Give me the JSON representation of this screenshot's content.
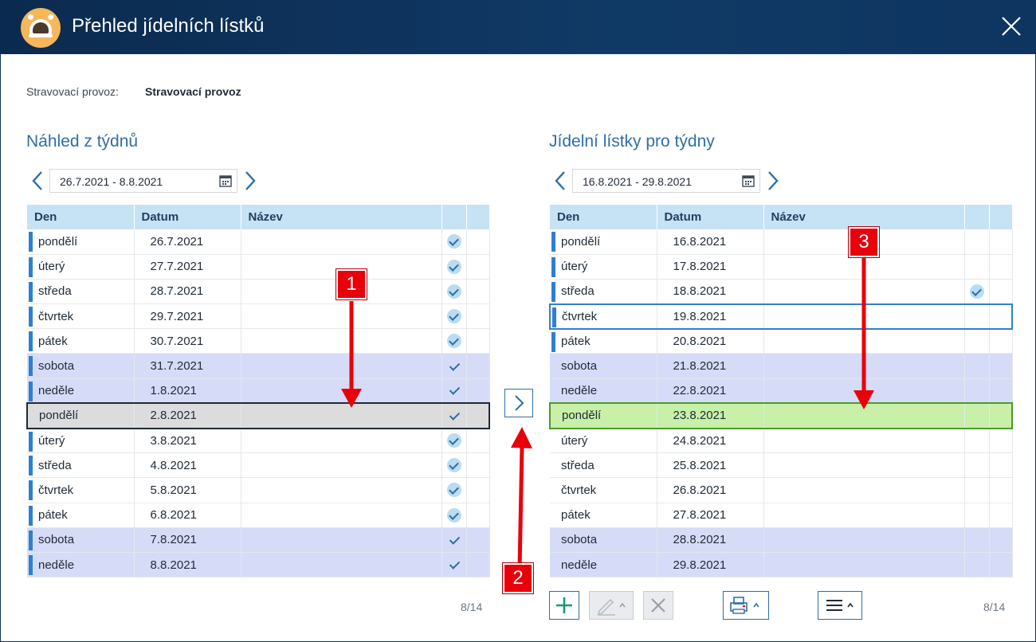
{
  "window": {
    "title": "Přehled jídelních lístků"
  },
  "provoz": {
    "label": "Stravovací provoz:",
    "value": "Stravovací provoz"
  },
  "left": {
    "title": "Náhled z týdnů",
    "date_range": "26.7.2021 - 8.8.2021",
    "columns": [
      "Den",
      "Datum",
      "Název"
    ],
    "rows": [
      {
        "day": "pondělí",
        "date": "26.7.2021",
        "check": "filled",
        "style": ""
      },
      {
        "day": "úterý",
        "date": "27.7.2021",
        "check": "filled",
        "style": ""
      },
      {
        "day": "středa",
        "date": "28.7.2021",
        "check": "filled",
        "style": ""
      },
      {
        "day": "čtvrtek",
        "date": "29.7.2021",
        "check": "filled",
        "style": ""
      },
      {
        "day": "pátek",
        "date": "30.7.2021",
        "check": "filled",
        "style": ""
      },
      {
        "day": "sobota",
        "date": "31.7.2021",
        "check": "plain",
        "style": "weekend"
      },
      {
        "day": "neděle",
        "date": "1.8.2021",
        "check": "plain",
        "style": "weekend"
      },
      {
        "day": "pondělí",
        "date": "2.8.2021",
        "check": "plain",
        "style": "sel-gray"
      },
      {
        "day": "úterý",
        "date": "3.8.2021",
        "check": "filled",
        "style": ""
      },
      {
        "day": "středa",
        "date": "4.8.2021",
        "check": "filled",
        "style": ""
      },
      {
        "day": "čtvrtek",
        "date": "5.8.2021",
        "check": "filled",
        "style": ""
      },
      {
        "day": "pátek",
        "date": "6.8.2021",
        "check": "filled",
        "style": ""
      },
      {
        "day": "sobota",
        "date": "7.8.2021",
        "check": "plain",
        "style": "weekend"
      },
      {
        "day": "neděle",
        "date": "8.8.2021",
        "check": "plain",
        "style": "weekend"
      }
    ],
    "counter": "8/14"
  },
  "right": {
    "title": "Jídelní lístky pro týdny",
    "date_range": "16.8.2021 - 29.8.2021",
    "columns": [
      "Den",
      "Datum",
      "Název"
    ],
    "rows": [
      {
        "day": "pondělí",
        "date": "16.8.2021",
        "check": "",
        "style": "",
        "bar": true
      },
      {
        "day": "úterý",
        "date": "17.8.2021",
        "check": "",
        "style": "",
        "bar": true
      },
      {
        "day": "středa",
        "date": "18.8.2021",
        "check": "filled",
        "style": "",
        "bar": true
      },
      {
        "day": "čtvrtek",
        "date": "19.8.2021",
        "check": "",
        "style": "focus-blue",
        "bar": true
      },
      {
        "day": "pátek",
        "date": "20.8.2021",
        "check": "",
        "style": "",
        "bar": true
      },
      {
        "day": "sobota",
        "date": "21.8.2021",
        "check": "",
        "style": "weekend",
        "bar": false
      },
      {
        "day": "neděle",
        "date": "22.8.2021",
        "check": "",
        "style": "weekend",
        "bar": false
      },
      {
        "day": "pondělí",
        "date": "23.8.2021",
        "check": "",
        "style": "sel-green",
        "bar": false
      },
      {
        "day": "úterý",
        "date": "24.8.2021",
        "check": "",
        "style": "",
        "bar": false
      },
      {
        "day": "středa",
        "date": "25.8.2021",
        "check": "",
        "style": "",
        "bar": false
      },
      {
        "day": "čtvrtek",
        "date": "26.8.2021",
        "check": "",
        "style": "",
        "bar": false
      },
      {
        "day": "pátek",
        "date": "27.8.2021",
        "check": "",
        "style": "",
        "bar": false
      },
      {
        "day": "sobota",
        "date": "28.8.2021",
        "check": "",
        "style": "weekend",
        "bar": false
      },
      {
        "day": "neděle",
        "date": "29.8.2021",
        "check": "",
        "style": "weekend",
        "bar": false
      }
    ],
    "counter": "8/14"
  },
  "callouts": {
    "one": "1",
    "two": "2",
    "three": "3"
  },
  "colors": {
    "titlebar": "#0e3560",
    "accent": "#2f6ea5",
    "weekend": "#d6dcf8",
    "selected_green": "#c8f0a8",
    "callout_red": "#e8000b"
  }
}
